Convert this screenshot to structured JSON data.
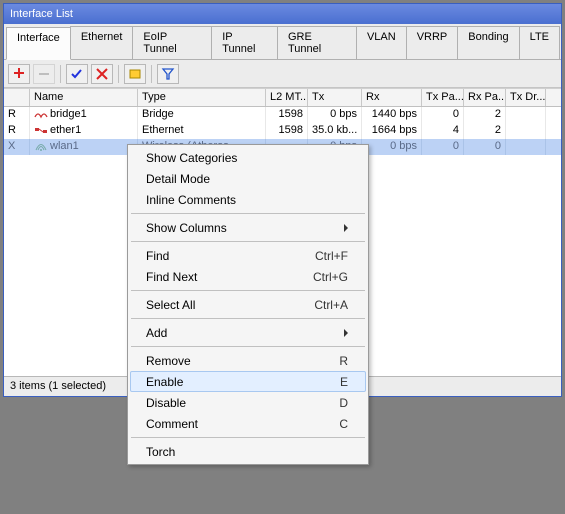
{
  "window": {
    "title": "Interface List"
  },
  "tabs": [
    "Interface",
    "Ethernet",
    "EoIP Tunnel",
    "IP Tunnel",
    "GRE Tunnel",
    "VLAN",
    "VRRP",
    "Bonding",
    "LTE"
  ],
  "active_tab": 0,
  "columns": [
    "",
    "Name",
    "Type",
    "L2 MT...",
    "Tx",
    "Rx",
    "Tx Pa...",
    "Rx Pa...",
    "Tx Dr..."
  ],
  "rows": [
    {
      "flag": "R",
      "name": "bridge1",
      "type": "Bridge",
      "l2": "1598",
      "tx": "0 bps",
      "rx": "1440 bps",
      "txp": "0",
      "rxp": "2",
      "txd": ""
    },
    {
      "flag": "R",
      "name": "ether1",
      "type": "Ethernet",
      "l2": "1598",
      "tx": "35.0 kb...",
      "rx": "1664 bps",
      "txp": "4",
      "rxp": "2",
      "txd": ""
    },
    {
      "flag": "X",
      "name": "wlan1",
      "type": "Wireless (Atheros...",
      "l2": "",
      "tx": "0 bps",
      "rx": "0 bps",
      "txp": "0",
      "rxp": "0",
      "txd": ""
    }
  ],
  "selected_row": 2,
  "status": "3 items (1 selected)",
  "context_menu": {
    "groups": [
      [
        {
          "label": "Show Categories",
          "accel": "",
          "sub": false
        },
        {
          "label": "Detail Mode",
          "accel": "",
          "sub": false
        },
        {
          "label": "Inline Comments",
          "accel": "",
          "sub": false
        }
      ],
      [
        {
          "label": "Show Columns",
          "accel": "",
          "sub": true
        }
      ],
      [
        {
          "label": "Find",
          "accel": "Ctrl+F",
          "sub": false
        },
        {
          "label": "Find Next",
          "accel": "Ctrl+G",
          "sub": false
        }
      ],
      [
        {
          "label": "Select All",
          "accel": "Ctrl+A",
          "sub": false
        }
      ],
      [
        {
          "label": "Add",
          "accel": "",
          "sub": true
        }
      ],
      [
        {
          "label": "Remove",
          "accel": "R",
          "sub": false
        },
        {
          "label": "Enable",
          "accel": "E",
          "sub": false,
          "hover": true
        },
        {
          "label": "Disable",
          "accel": "D",
          "sub": false
        },
        {
          "label": "Comment",
          "accel": "C",
          "sub": false
        }
      ],
      [
        {
          "label": "Torch",
          "accel": "",
          "sub": false
        }
      ]
    ]
  },
  "icons": {
    "bridge_svg": "bridge-icon",
    "ether_svg": "ethernet-icon",
    "wlan_svg": "wireless-icon"
  }
}
